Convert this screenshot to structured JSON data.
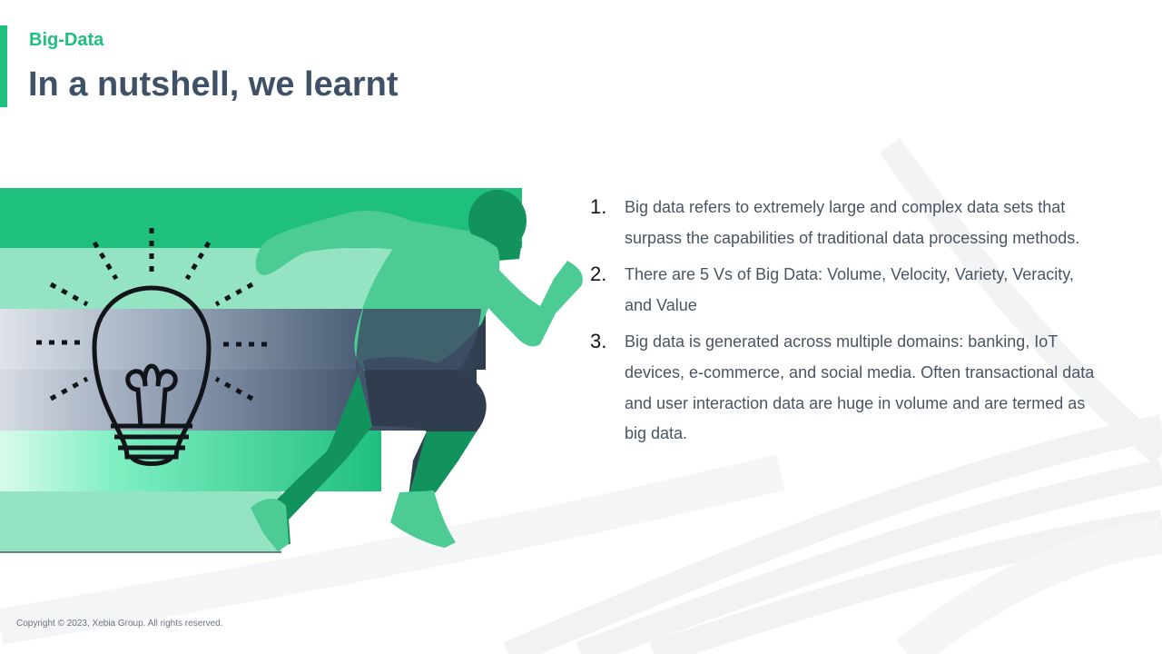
{
  "header": {
    "kicker": "Big-Data",
    "title": "In a nutshell, we learnt"
  },
  "points": [
    {
      "number": "1.",
      "text": "Big data refers to extremely large and complex data sets that surpass the capabilities of traditional data processing methods."
    },
    {
      "number": "2.",
      "text": "There are 5 Vs of Big Data: Volume, Velocity, Variety, Veracity, and Value"
    },
    {
      "number": "3.",
      "text": "Big data is generated across multiple domains: banking, IoT devices, e-commerce, and social media. Often transactional data and user interaction data are huge in volume and are termed as big data."
    }
  ],
  "footer": {
    "copyright": "Copyright © 2023, Xebia Group. All rights reserved."
  },
  "colors": {
    "brand_green": "#1fbf7e",
    "title_slate": "#3e5166",
    "dark_navy": "#2f3d4e"
  },
  "illustration": {
    "icons": [
      "lightbulb-icon",
      "runner-silhouette"
    ]
  }
}
